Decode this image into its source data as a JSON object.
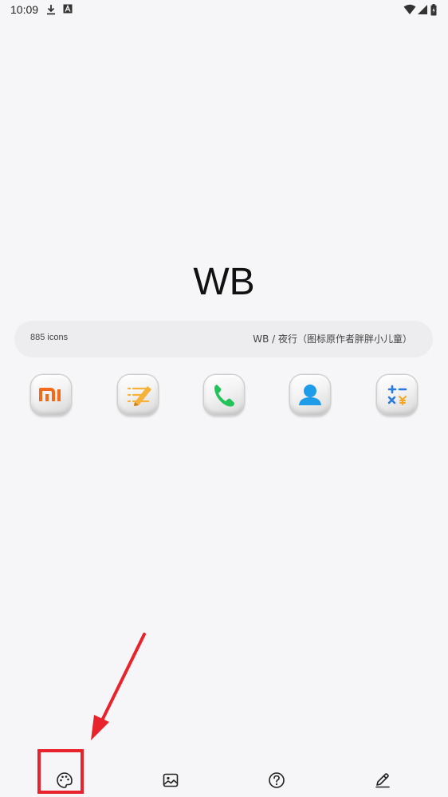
{
  "status_bar": {
    "time": "10:09",
    "left_icons": [
      "download-icon",
      "font-icon"
    ],
    "right_icons": [
      "wifi-icon",
      "signal-icon",
      "battery-icon"
    ]
  },
  "title": "WB",
  "info": {
    "icon_count": "885 icons",
    "pack_author": "WB / 夜行（图标原作者胖胖小儿童）"
  },
  "app_icons": [
    {
      "name": "mi-icon",
      "color": "#f26a1b"
    },
    {
      "name": "notes-icon",
      "color": "#f7b23a"
    },
    {
      "name": "phone-icon",
      "color": "#22c35a"
    },
    {
      "name": "contacts-icon",
      "color": "#1e9be9"
    },
    {
      "name": "calculator-icon",
      "color": "#2a7be0"
    }
  ],
  "bottom_nav": [
    {
      "name": "palette-icon"
    },
    {
      "name": "image-icon"
    },
    {
      "name": "help-icon"
    },
    {
      "name": "edit-icon"
    }
  ],
  "annotation": {
    "color": "#e8232c"
  }
}
